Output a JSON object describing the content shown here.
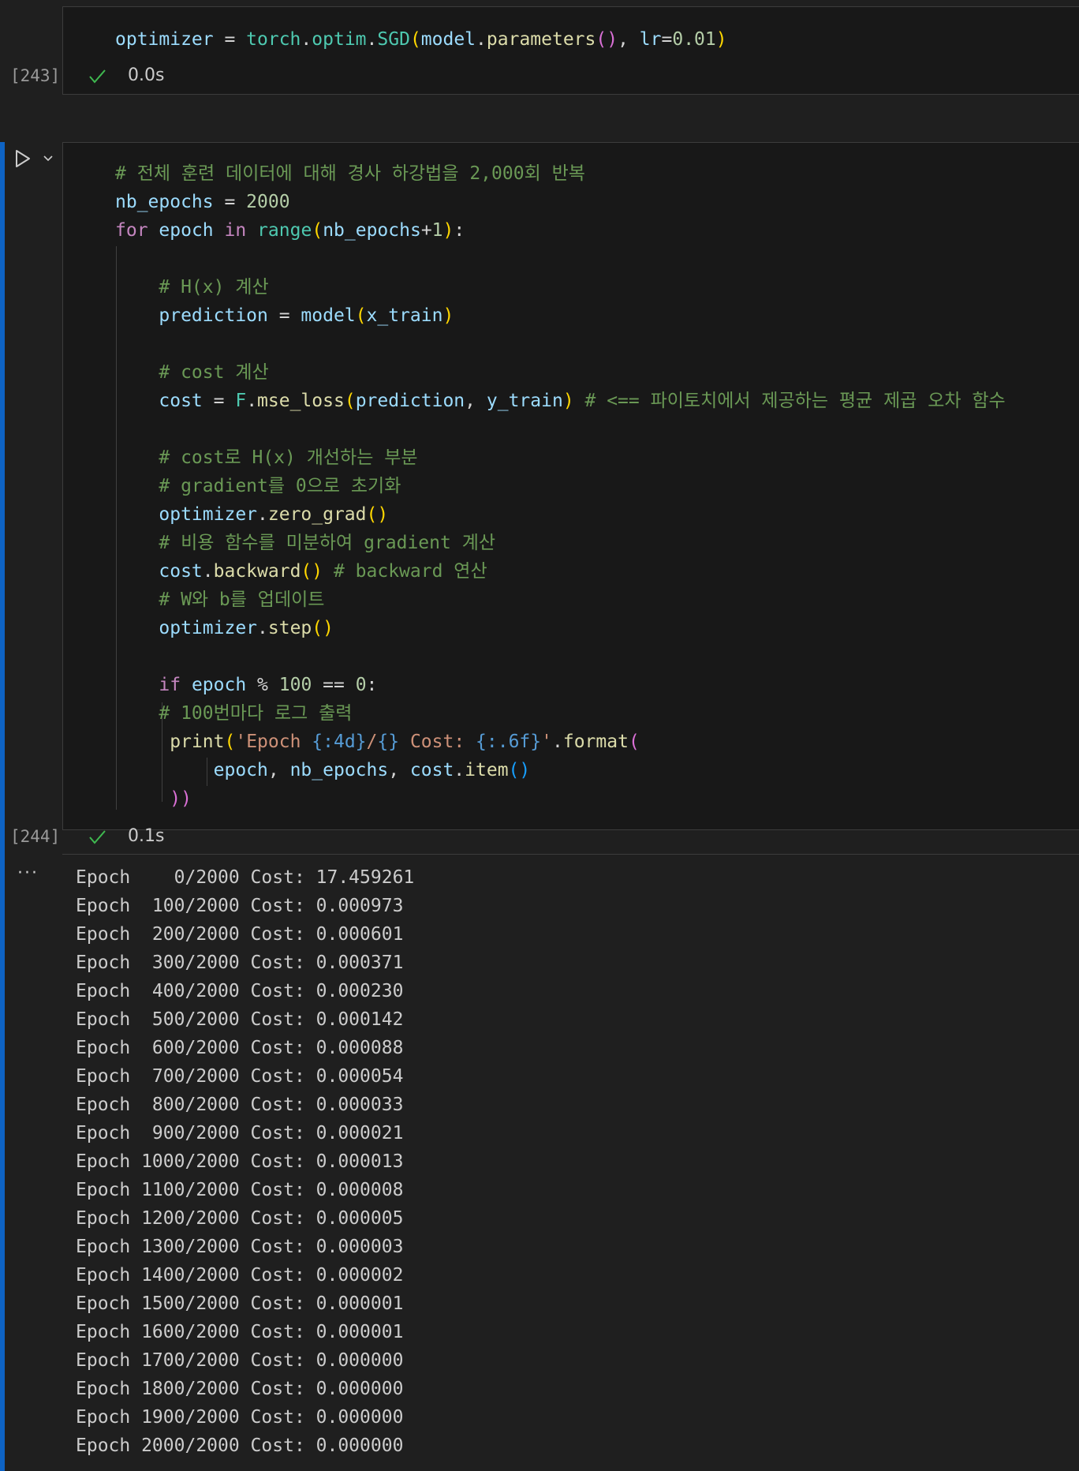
{
  "cell_243": {
    "exec_count": "[243]",
    "status_time": "0.0s",
    "code": {
      "l1": {
        "a": "optimizer",
        "b": " = ",
        "c": "torch",
        "d": ".",
        "e": "optim",
        "f": ".",
        "g": "SGD",
        "h": "(",
        "i": "model",
        "j": ".",
        "k": "parameters",
        "l": "()",
        "m": ", ",
        "n": "lr",
        "o": "=",
        "p": "0.01",
        "q": ")"
      }
    }
  },
  "cell_244": {
    "exec_count": "[244]",
    "status_time": "0.1s",
    "code": {
      "l1": "# 전체 훈련 데이터에 대해 경사 하강법을 2,000회 반복",
      "l2": {
        "a": "nb_epochs",
        "b": " = ",
        "c": "2000"
      },
      "l3": {
        "a": "for",
        "b": " ",
        "c": "epoch",
        "d": " ",
        "e": "in",
        "f": " ",
        "g": "range",
        "h": "(",
        "i": "nb_epochs",
        "j": "+",
        "k": "1",
        "l": ")",
        "m": ":"
      },
      "l4": "",
      "l5": "    # H(x) 계산",
      "l6": {
        "a": "    ",
        "b": "prediction",
        "c": " = ",
        "d": "model",
        "e": "(",
        "f": "x_train",
        "g": ")"
      },
      "l7": "",
      "l8": "    # cost 계산",
      "l9": {
        "a": "    ",
        "b": "cost",
        "c": " = ",
        "d": "F",
        "e": ".",
        "f": "mse_loss",
        "g": "(",
        "h": "prediction",
        "i": ", ",
        "j": "y_train",
        "k": ")",
        "l": " # <== 파이토치에서 제공하는 평균 제곱 오차 함수"
      },
      "l10": "",
      "l11": "    # cost로 H(x) 개선하는 부분",
      "l12": "    # gradient를 0으로 초기화",
      "l13": {
        "a": "    ",
        "b": "optimizer",
        "c": ".",
        "d": "zero_grad",
        "e": "()"
      },
      "l14": "    # 비용 함수를 미분하여 gradient 계산",
      "l15": {
        "a": "    ",
        "b": "cost",
        "c": ".",
        "d": "backward",
        "e": "()",
        "f": " # backward 연산"
      },
      "l16": "    # W와 b를 업데이트",
      "l17": {
        "a": "    ",
        "b": "optimizer",
        "c": ".",
        "d": "step",
        "e": "()"
      },
      "l18": "",
      "l19": {
        "a": "    ",
        "b": "if",
        "c": " ",
        "d": "epoch",
        "e": " % ",
        "f": "100",
        "g": " == ",
        "h": "0",
        "i": ":"
      },
      "l20": "    # 100번마다 로그 출력",
      "l21": {
        "a": "     ",
        "b": "print",
        "c": "(",
        "d": "'Epoch ",
        "e": "{:4d}",
        "f": "/",
        "g": "{}",
        "h": " Cost: ",
        "i": "{:.6f}",
        "j": "'",
        "k": ".",
        "l": "format",
        "m": "("
      },
      "l22": {
        "a": "         ",
        "b": "epoch",
        "c": ", ",
        "d": "nb_epochs",
        "e": ", ",
        "f": "cost",
        "g": ".",
        "h": "item",
        "i": "()"
      },
      "l23": {
        "a": "     ",
        "b": "))"
      }
    },
    "output": [
      "Epoch    0/2000 Cost: 17.459261",
      "Epoch  100/2000 Cost: 0.000973",
      "Epoch  200/2000 Cost: 0.000601",
      "Epoch  300/2000 Cost: 0.000371",
      "Epoch  400/2000 Cost: 0.000230",
      "Epoch  500/2000 Cost: 0.000142",
      "Epoch  600/2000 Cost: 0.000088",
      "Epoch  700/2000 Cost: 0.000054",
      "Epoch  800/2000 Cost: 0.000033",
      "Epoch  900/2000 Cost: 0.000021",
      "Epoch 1000/2000 Cost: 0.000013",
      "Epoch 1100/2000 Cost: 0.000008",
      "Epoch 1200/2000 Cost: 0.000005",
      "Epoch 1300/2000 Cost: 0.000003",
      "Epoch 1400/2000 Cost: 0.000002",
      "Epoch 1500/2000 Cost: 0.000001",
      "Epoch 1600/2000 Cost: 0.000001",
      "Epoch 1700/2000 Cost: 0.000000",
      "Epoch 1800/2000 Cost: 0.000000",
      "Epoch 1900/2000 Cost: 0.000000",
      "Epoch 2000/2000 Cost: 0.000000"
    ]
  },
  "icons": {
    "run": "run-icon",
    "chevron": "chevron-down-icon",
    "check": "check-icon",
    "more": "more-actions-icon"
  },
  "colors": {
    "accent_bar": "#0e63c4",
    "success_check": "#3fb950"
  }
}
